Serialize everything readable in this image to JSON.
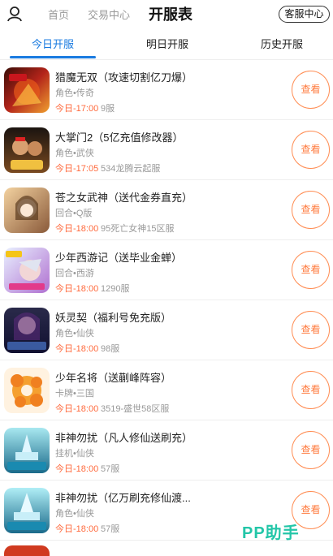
{
  "header": {
    "home_label": "首页",
    "trade_label": "交易中心",
    "title": "开服表",
    "service_label": "客服中心"
  },
  "tabs": [
    {
      "label": "今日开服",
      "active": true
    },
    {
      "label": "明日开服",
      "active": false
    },
    {
      "label": "历史开服",
      "active": false
    }
  ],
  "colors": {
    "accent": "#1a7be0",
    "orange": "#ff7a3d",
    "watermark": "#23c6a8"
  },
  "games": [
    {
      "name": "猎魔无双（攻速切割亿刀爆）",
      "category": "角色•传奇",
      "time": "今日-17:00",
      "server": "9服",
      "button": "查看"
    },
    {
      "name": "大掌门2（5亿充值修改器）",
      "category": "角色•武侠",
      "time": "今日-17:05",
      "server": "534龙腾云起服",
      "button": "查看"
    },
    {
      "name": "苍之女武神（送代金券直充）",
      "category": "回合•Q版",
      "time": "今日-18:00",
      "server": "95死亡女神15区服",
      "button": "查看"
    },
    {
      "name": "少年西游记（送毕业金蝉）",
      "category": "回合•西游",
      "time": "今日-18:00",
      "server": "1290服",
      "button": "查看"
    },
    {
      "name": "妖灵契（福利号免充版）",
      "category": "角色•仙侠",
      "time": "今日-18:00",
      "server": "98服",
      "button": "查看"
    },
    {
      "name": "少年名将（送蒯峰阵容）",
      "category": "卡牌•三国",
      "time": "今日-18:00",
      "server": "3519-盛世58区服",
      "button": "查看"
    },
    {
      "name": "非神勿扰（凡人修仙送刷充）",
      "category": "挂机•仙侠",
      "time": "今日-18:00",
      "server": "57服",
      "button": "查看"
    },
    {
      "name": "非神勿扰（亿万刷充修仙渡...",
      "category": "角色•仙侠",
      "time": "今日-18:00",
      "server": "57服",
      "button": "查看"
    }
  ],
  "watermark": "PP助手"
}
